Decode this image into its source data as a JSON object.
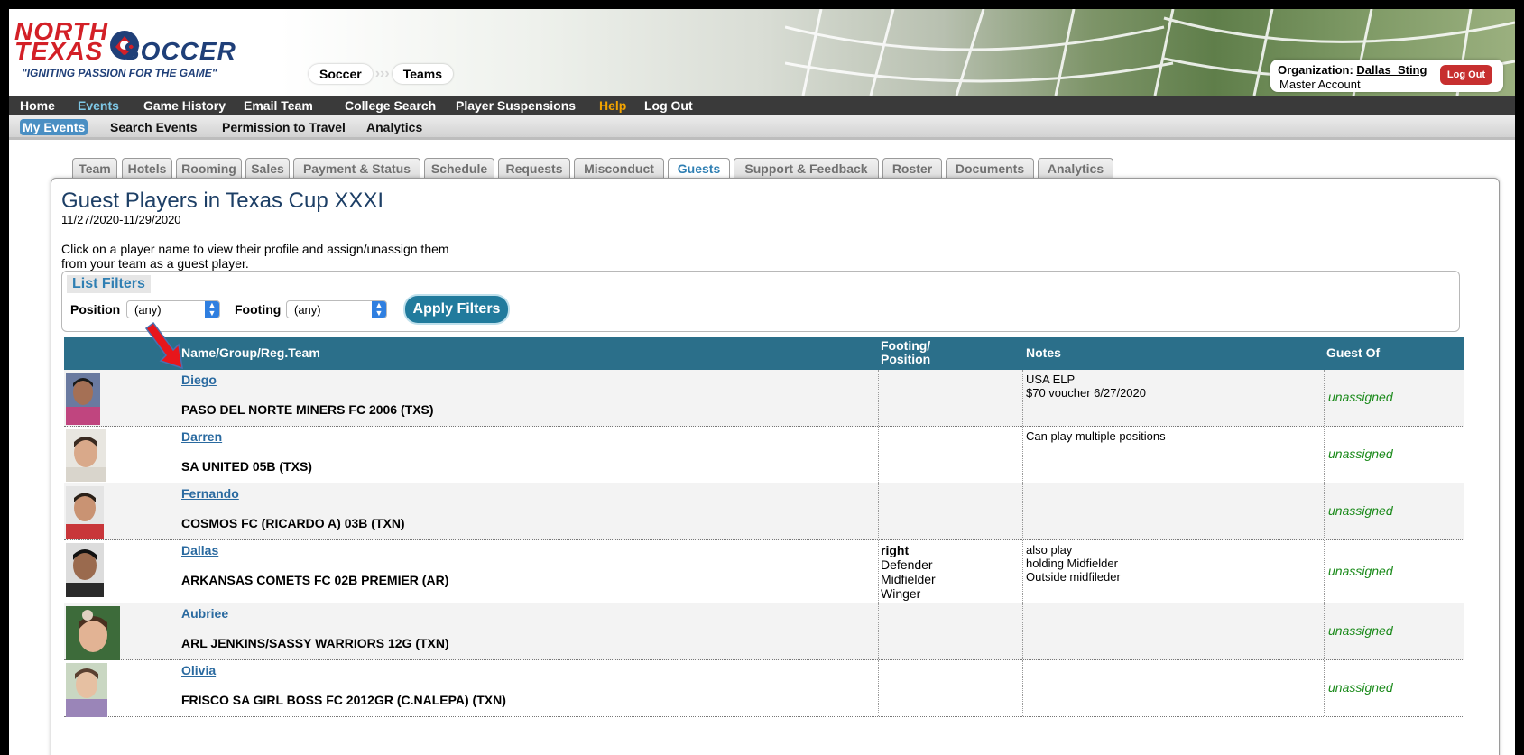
{
  "header": {
    "logo_line1": "NORTH",
    "logo_line2": "TEXAS",
    "logo_line2b": "SOCCER",
    "logo_tagline": "\"IGNITING PASSION FOR THE GAME\"",
    "breadcrumbs": [
      "Soccer",
      "Teams"
    ],
    "org_label": "Organization:",
    "org_name": "Dallas_Sting",
    "org_account": "Master Account",
    "logout_label": "Log Out"
  },
  "main_nav": [
    "Home",
    "Events",
    "Game History",
    "Email Team",
    "College Search",
    "Player Suspensions",
    "Help",
    "Log Out"
  ],
  "sub_nav": [
    "My Events",
    "Search Events",
    "Permission to Travel",
    "Analytics"
  ],
  "tabs": [
    "Team",
    "Hotels",
    "Rooming",
    "Sales",
    "Payment & Status",
    "Schedule",
    "Requests",
    "Misconduct",
    "Guests",
    "Support & Feedback",
    "Roster",
    "Documents",
    "Analytics"
  ],
  "active_tab": "Guests",
  "page": {
    "title": "Guest Players in Texas Cup XXXI",
    "date_range": "11/27/2020-11/29/2020",
    "instructions": "Click on a player name to view their profile and assign/unassign them from your team as a guest player."
  },
  "filters": {
    "title": "List Filters",
    "position_label": "Position",
    "position_value": "(any)",
    "footing_label": "Footing",
    "footing_value": "(any)",
    "apply_label": "Apply Filters"
  },
  "table": {
    "headers": {
      "name": "Name/Group/Reg.Team",
      "footing_line1": "Footing/",
      "footing_line2": "Position",
      "notes": "Notes",
      "guest_of": "Guest Of"
    },
    "rows": [
      {
        "name": "Diego",
        "team": "PASO DEL NORTE MINERS FC 2006 (TXS)",
        "footing": "",
        "positions": [],
        "notes": [
          "USA ELP",
          "$70 voucher 6/27/2020"
        ],
        "guest_of": "unassigned"
      },
      {
        "name": "Darren",
        "team": "SA UNITED 05B (TXS)",
        "footing": "",
        "positions": [],
        "notes": [
          "Can play multiple positions"
        ],
        "guest_of": "unassigned"
      },
      {
        "name": "Fernando",
        "team": "COSMOS FC (RICARDO A) 03B (TXN)",
        "footing": "",
        "positions": [],
        "notes": [],
        "guest_of": "unassigned"
      },
      {
        "name": "Dallas",
        "team": "ARKANSAS COMETS FC 02B PREMIER (AR)",
        "footing": "right",
        "positions": [
          "Defender",
          "Midfielder",
          "Winger"
        ],
        "notes": [
          "also play",
          "holding Midfielder",
          "Outside midfileder"
        ],
        "guest_of": "unassigned"
      },
      {
        "name": "Aubriee",
        "team": "ARL JENKINS/SASSY WARRIORS 12G (TXN)",
        "footing": "",
        "positions": [],
        "notes": [],
        "guest_of": "unassigned"
      },
      {
        "name": "Olivia",
        "team": "FRISCO SA GIRL BOSS FC 2012GR (C.NALEPA) (TXN)",
        "footing": "",
        "positions": [],
        "notes": [],
        "guest_of": "unassigned"
      }
    ]
  },
  "colors": {
    "nav_bar": "#3a3a3a",
    "table_header": "#2b6f8a",
    "link": "#2a6aa0",
    "unassigned": "#1a8a1a",
    "logout_button": "#c72f2f",
    "apply_button": "#217b9d"
  }
}
